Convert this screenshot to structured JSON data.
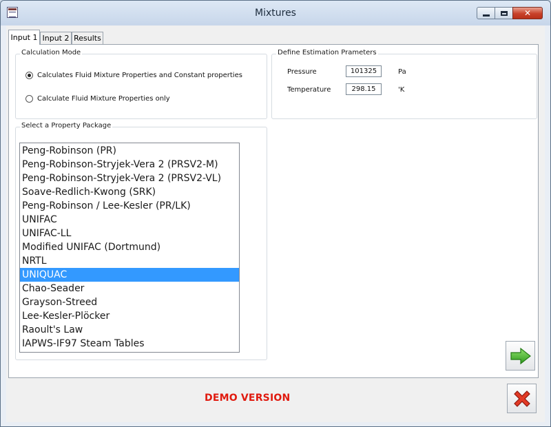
{
  "window": {
    "title": "Mixtures",
    "icon": "app-icon",
    "controls": [
      "minimize-icon",
      "maximize-icon",
      "close-icon"
    ]
  },
  "tabs": [
    {
      "label": "Input 1",
      "active": true
    },
    {
      "label": "Input 2",
      "active": false
    },
    {
      "label": "Results",
      "active": false
    }
  ],
  "calculation_mode": {
    "legend": "Calculation Mode",
    "options": [
      {
        "label": "Calculates Fluid Mixture Properties and Constant properties",
        "checked": true
      },
      {
        "label": "Calculate Fluid Mixture Properties only",
        "checked": false
      }
    ]
  },
  "estimation": {
    "legend": "Define Estimation Prameters",
    "pressure": {
      "label": "Pressure",
      "value": "101325",
      "unit": "Pa"
    },
    "temperature": {
      "label": "Temperature",
      "value": "298.15",
      "unit": "'K"
    }
  },
  "property_package": {
    "legend": "Select a Property Package",
    "selected": "UNIQUAC",
    "items": [
      "Peng-Robinson (PR)",
      "Peng-Robinson-Stryjek-Vera 2 (PRSV2-M)",
      "Peng-Robinson-Stryjek-Vera 2 (PRSV2-VL)",
      "Soave-Redlich-Kwong (SRK)",
      "Peng-Robinson / Lee-Kesler (PR/LK)",
      "UNIFAC",
      "UNIFAC-LL",
      "Modified UNIFAC (Dortmund)",
      "NRTL",
      "UNIQUAC",
      "Chao-Seader",
      "Grayson-Streed",
      "Lee-Kesler-Plöcker",
      "Raoult's Law",
      "IAPWS-IF97 Steam Tables"
    ]
  },
  "buttons": {
    "next_icon": "arrow-right-icon",
    "cancel_icon": "red-x-icon"
  },
  "footer": {
    "demo_label": "DEMO VERSION"
  },
  "colors": {
    "selection": "#3399ff",
    "demo_text": "#e01a0f",
    "next_arrow": "#3fae2a",
    "cancel_x": "#e03a2a"
  }
}
